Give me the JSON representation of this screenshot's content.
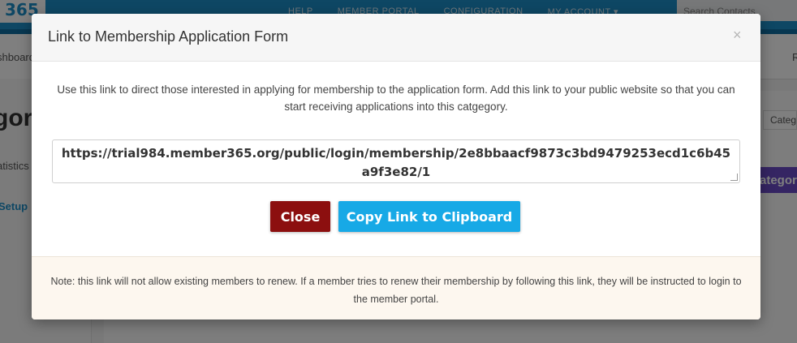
{
  "background": {
    "logo_text": "365",
    "top_nav": [
      "HELP",
      "MEMBER PORTAL",
      "CONFIGURATION",
      "MY ACCOUNT ▾"
    ],
    "search_placeholder": "Search Contacts",
    "subnav_left": "shboard",
    "subnav_right": "R",
    "page_title": "gory",
    "statistics_label": "atistics",
    "setup_label": "Setup",
    "category_button": "Categ",
    "category_button2": "ategor"
  },
  "modal": {
    "title": "Link to Membership Application Form",
    "close_icon": "×",
    "intro": "Use this link to direct those interested in applying for membership to the application form. Add this link to your public website so that you can start receiving applications into this catgegory.",
    "url": "https://trial984.member365.org/public/login/membership/2e8bbaacf9873c3bd9479253ecd1c6b45a9f3e82/1",
    "close_label": "Close",
    "copy_label": "Copy Link to Clipboard",
    "note": "Note: this link will not allow existing members to renew. If a member tries to renew their membership by following this link, they will be instructed to login to the member portal."
  },
  "colors": {
    "close_button": "#8c0f0f",
    "copy_button": "#17a9e6",
    "footer_bg": "#fdf7ef",
    "topbar": "#1c8fc9"
  }
}
